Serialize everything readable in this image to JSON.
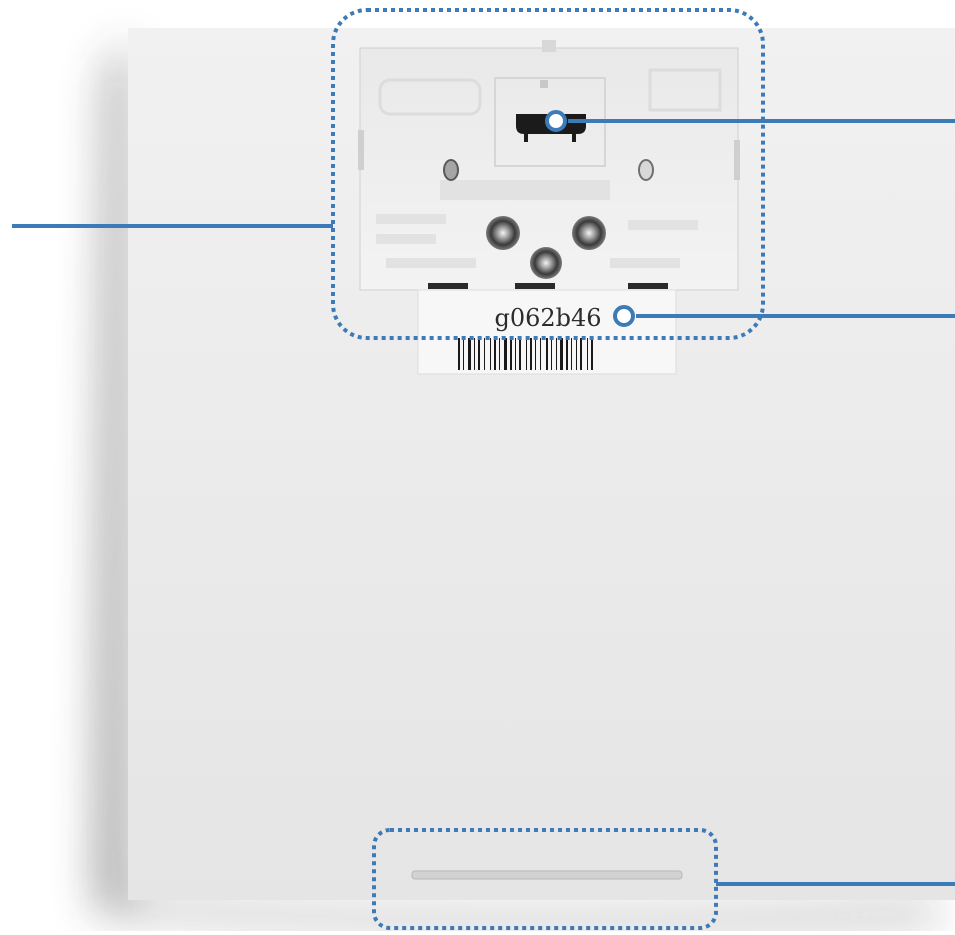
{
  "device": {
    "label_code": "g062b46"
  },
  "colors": {
    "callout": "#3d7ab8",
    "panel": "#e7e7e7",
    "recess": "#ececec",
    "shadow": "#4a4a4a"
  },
  "icons": [
    "micro-usb-port-icon",
    "mounting-bracket-icon",
    "barcode-icon",
    "screw-icon"
  ]
}
